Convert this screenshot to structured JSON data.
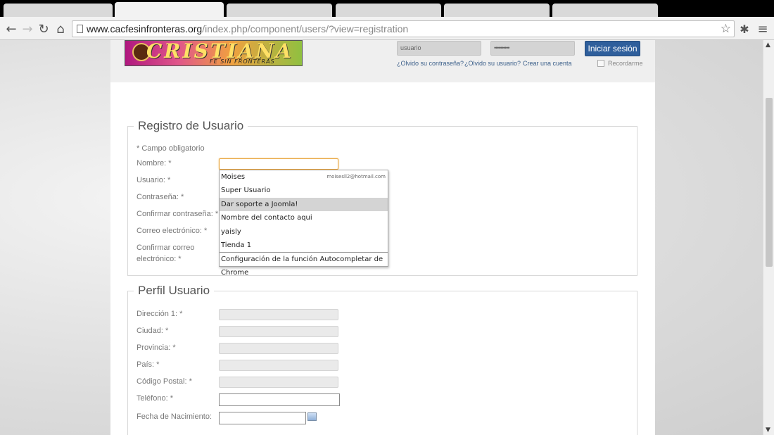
{
  "browser": {
    "url_host": "www.cacfesinfronteras.org",
    "url_path": "/index.php/component/users/?view=registration"
  },
  "header": {
    "logo_text": "CRISTIANA",
    "logo_subtitle": "FE SIN FRONTERAS",
    "username_placeholder": "usuario",
    "password_value": "••••••••••",
    "login_button": "Iniciar sesión",
    "forgot_password": "¿Olvido su contraseña?",
    "forgot_username": "¿Olvido su usuario?",
    "create_account": "Crear una cuenta",
    "remember_me": "Recordarme"
  },
  "registration": {
    "legend": "Registro de Usuario",
    "required_note": "* Campo obligatorio",
    "labels": {
      "name": "Nombre: *",
      "username": "Usuario: *",
      "password": "Contraseña: *",
      "confirm_password": "Confirmar contraseña: *",
      "email": "Correo electrónico: *",
      "confirm_email_line1": "Confirmar correo",
      "confirm_email_line2": "electrónico: *"
    }
  },
  "autocomplete": {
    "items": [
      {
        "label": "Moises",
        "sub": "moisesll2@hotmail.com"
      },
      {
        "label": "Super Usuario",
        "sub": ""
      },
      {
        "label": "Dar soporte a Joomla!",
        "sub": ""
      },
      {
        "label": "Nombre del contacto aqui",
        "sub": ""
      },
      {
        "label": "yaisly",
        "sub": ""
      },
      {
        "label": "Tienda 1",
        "sub": ""
      }
    ],
    "selected_index": 2,
    "settings_label": "Configuración de la función Autocompletar de Chrome"
  },
  "profile": {
    "legend": "Perfil Usuario",
    "labels": {
      "address": "Dirección 1: *",
      "city": "Ciudad: *",
      "province": "Provincia: *",
      "country": "País: *",
      "postal_code": "Código Postal: *",
      "phone": "Teléfono: *",
      "birth_date": "Fecha de Nacimiento:"
    }
  }
}
